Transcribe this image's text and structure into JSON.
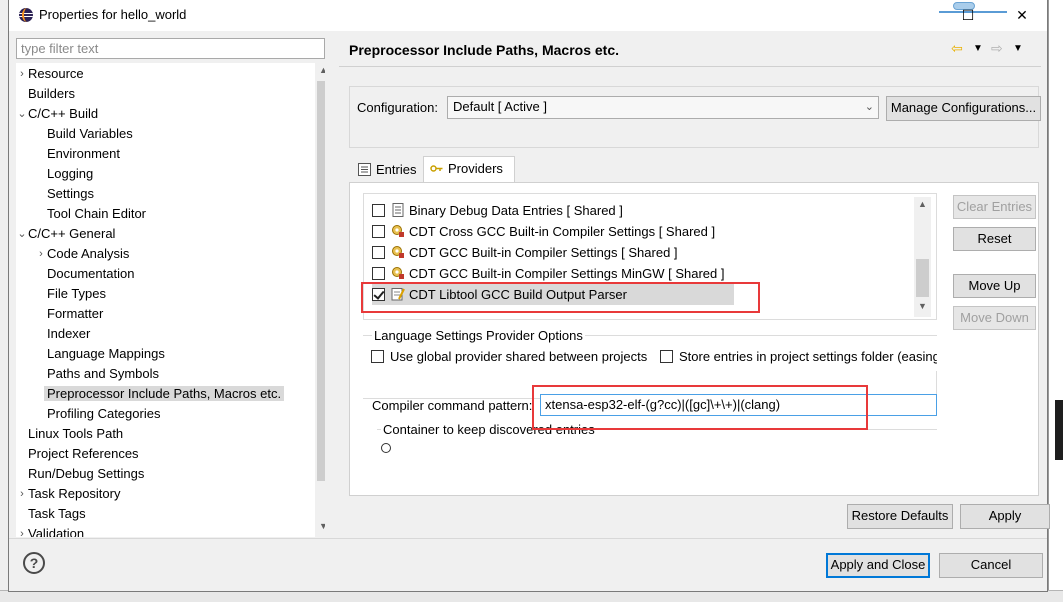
{
  "window": {
    "title": "Properties for hello_world"
  },
  "filter": {
    "placeholder": "type filter text"
  },
  "tree": [
    {
      "label": "Resource",
      "expander": "›",
      "level": 0
    },
    {
      "label": "Builders",
      "expander": "",
      "level": 0
    },
    {
      "label": "C/C++ Build",
      "expander": "⌄",
      "level": 0
    },
    {
      "label": "Build Variables",
      "expander": "",
      "level": 1
    },
    {
      "label": "Environment",
      "expander": "",
      "level": 1
    },
    {
      "label": "Logging",
      "expander": "",
      "level": 1
    },
    {
      "label": "Settings",
      "expander": "",
      "level": 1
    },
    {
      "label": "Tool Chain Editor",
      "expander": "",
      "level": 1
    },
    {
      "label": "C/C++ General",
      "expander": "⌄",
      "level": 0
    },
    {
      "label": "Code Analysis",
      "expander": "›",
      "level": 1
    },
    {
      "label": "Documentation",
      "expander": "",
      "level": 1
    },
    {
      "label": "File Types",
      "expander": "",
      "level": 1
    },
    {
      "label": "Formatter",
      "expander": "",
      "level": 1
    },
    {
      "label": "Indexer",
      "expander": "",
      "level": 1
    },
    {
      "label": "Language Mappings",
      "expander": "",
      "level": 1
    },
    {
      "label": "Paths and Symbols",
      "expander": "",
      "level": 1
    },
    {
      "label": "Preprocessor Include Paths, Macros etc.",
      "expander": "",
      "level": 1,
      "selected": true
    },
    {
      "label": "Profiling Categories",
      "expander": "",
      "level": 1
    },
    {
      "label": "Linux Tools Path",
      "expander": "",
      "level": 0
    },
    {
      "label": "Project References",
      "expander": "",
      "level": 0
    },
    {
      "label": "Run/Debug Settings",
      "expander": "",
      "level": 0
    },
    {
      "label": "Task Repository",
      "expander": "›",
      "level": 0
    },
    {
      "label": "Task Tags",
      "expander": "",
      "level": 0
    },
    {
      "label": "Validation",
      "expander": "›",
      "level": 0
    }
  ],
  "page": {
    "title": "Preprocessor Include Paths, Macros etc.",
    "configuration_label": "Configuration:",
    "configuration_value": "Default  [ Active ]",
    "manage_button": "Manage Configurations...",
    "tabs": {
      "entries": "Entries",
      "providers": "Providers"
    },
    "providers": [
      {
        "label": "Binary Debug Data Entries   [ Shared ]",
        "checked": false,
        "icon": "binary-icon"
      },
      {
        "label": "CDT Cross GCC Built-in Compiler Settings   [ Shared ]",
        "checked": false,
        "icon": "gear-icon"
      },
      {
        "label": "CDT GCC Built-in Compiler Settings   [ Shared ]",
        "checked": false,
        "icon": "gear-icon"
      },
      {
        "label": "CDT GCC Built-in Compiler Settings MinGW   [ Shared ]",
        "checked": false,
        "icon": "gear-icon"
      },
      {
        "label": "CDT Libtool GCC Build Output Parser",
        "checked": true,
        "icon": "parser-icon"
      }
    ],
    "side_buttons": {
      "clear_entries": "Clear Entries",
      "reset": "Reset",
      "move_up": "Move Up",
      "move_down": "Move Down"
    },
    "options_title": "Language Settings Provider Options",
    "use_global": "Use global provider shared between projects",
    "store_entries": "Store entries in project settings folder (easing project miscellaneous settings sharing)",
    "cmd_label": "Compiler command pattern:",
    "cmd_value": "xtensa-esp32-elf-(g?cc)|([gc]\\+\\+)|(clang)",
    "container_title": "Container to keep discovered entries",
    "restore_defaults": "Restore Defaults",
    "apply": "Apply"
  },
  "footer": {
    "apply_close": "Apply and Close",
    "cancel": "Cancel"
  },
  "colors": {
    "accent": "#0078d7",
    "highlight": "#e8393a",
    "selection": "#d9d9d9"
  }
}
